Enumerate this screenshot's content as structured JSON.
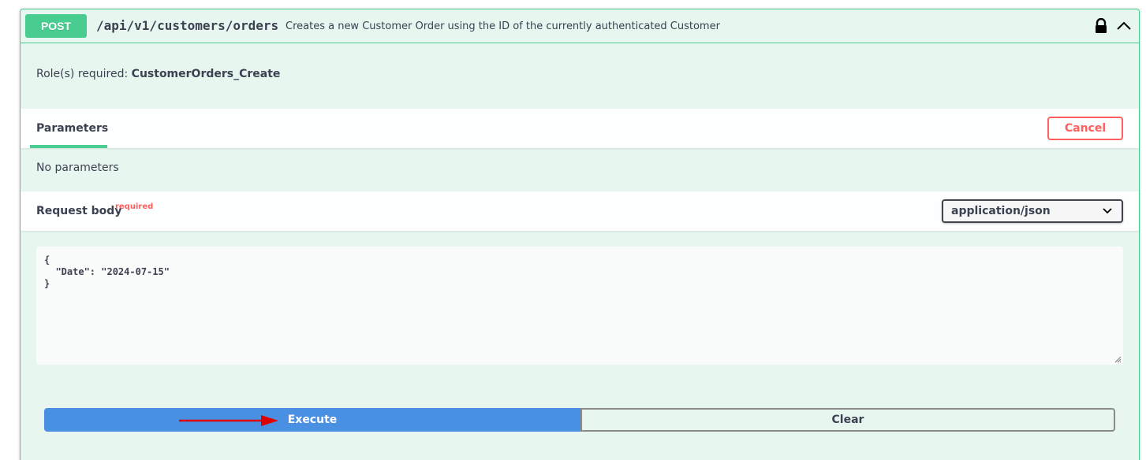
{
  "operation": {
    "method": "POST",
    "path": "/api/v1/customers/orders",
    "description": "Creates a new Customer Order using the ID of the currently authenticated Customer",
    "icons": [
      "lock-icon",
      "chevron-up-icon"
    ],
    "method_color": "#49cc90"
  },
  "roles": {
    "label": "Role(s) required:",
    "value": "CustomerOrders_Create"
  },
  "parameters": {
    "tab_label": "Parameters",
    "cancel_label": "Cancel",
    "empty_text": "No parameters"
  },
  "request_body": {
    "title": "Request body",
    "required_label": "required",
    "content_type": "application/json",
    "body_text": "{\n  \"Date\": \"2024-07-15\"\n}"
  },
  "actions": {
    "execute_label": "Execute",
    "clear_label": "Clear",
    "execute_color": "#4990e2",
    "annotation_arrow_color": "#e00000"
  }
}
